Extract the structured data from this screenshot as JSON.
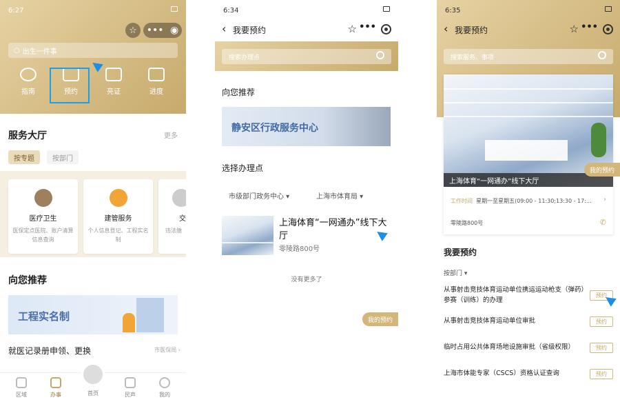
{
  "panel1": {
    "time": "6:27",
    "search_placeholder": "出生一件事",
    "quick": [
      "指南",
      "预约",
      "亮证",
      "进度"
    ],
    "hall_title": "服务大厅",
    "hall_more": "更多",
    "tabs": [
      "按专题",
      "按部门"
    ],
    "cards": [
      {
        "title": "医疗卫生",
        "desc": "医保定点医院、账户清算信息查询"
      },
      {
        "title": "建管服务",
        "desc": "个人信息登记、工程实名制"
      },
      {
        "title": "交",
        "desc": "违法缴"
      }
    ],
    "rec_title": "向您推荐",
    "banner": "工程实名制",
    "link_text": "就医记录册申领、更换",
    "link_source": "市医保局",
    "tabbar": [
      "区域",
      "办事",
      "首页",
      "民声",
      "我的"
    ]
  },
  "panel2": {
    "time": "6:34",
    "nav_title": "我要预约",
    "search_placeholder": "搜索办理点",
    "rec_title": "向您推荐",
    "banner": "静安区行政服务中心",
    "select_title": "选择办理点",
    "filters": [
      "市级部门政务中心",
      "上海市体育局"
    ],
    "venue_title": "上海体育“一网通办”线下大厅",
    "venue_addr": "零陵路800号",
    "no_more": "没有更多了",
    "my_booking": "我的预约"
  },
  "panel3": {
    "time": "6:35",
    "nav_title": "我要预约",
    "search_placeholder": "搜索服务、事项",
    "venue_caption": "上海体育“一网通办”线下大厅",
    "my_booking": "我的预约",
    "hours_label": "工作时间",
    "hours": "星期一至星期五(09:00 - 11:30;13:30 - 17:...",
    "addr": "零陵路800号",
    "section": "我要预约",
    "by_dept": "按部门",
    "items": [
      "从事射击竞技体育运动单位携运运动枪支（弹药）参赛（训练）的办理",
      "从事射击竞技体育运动单位审批",
      "临时占用公共体育场地设施审批（省级权限）",
      "上海市体能专家（CSCS）资格认证查询"
    ],
    "book_label": "预约"
  }
}
